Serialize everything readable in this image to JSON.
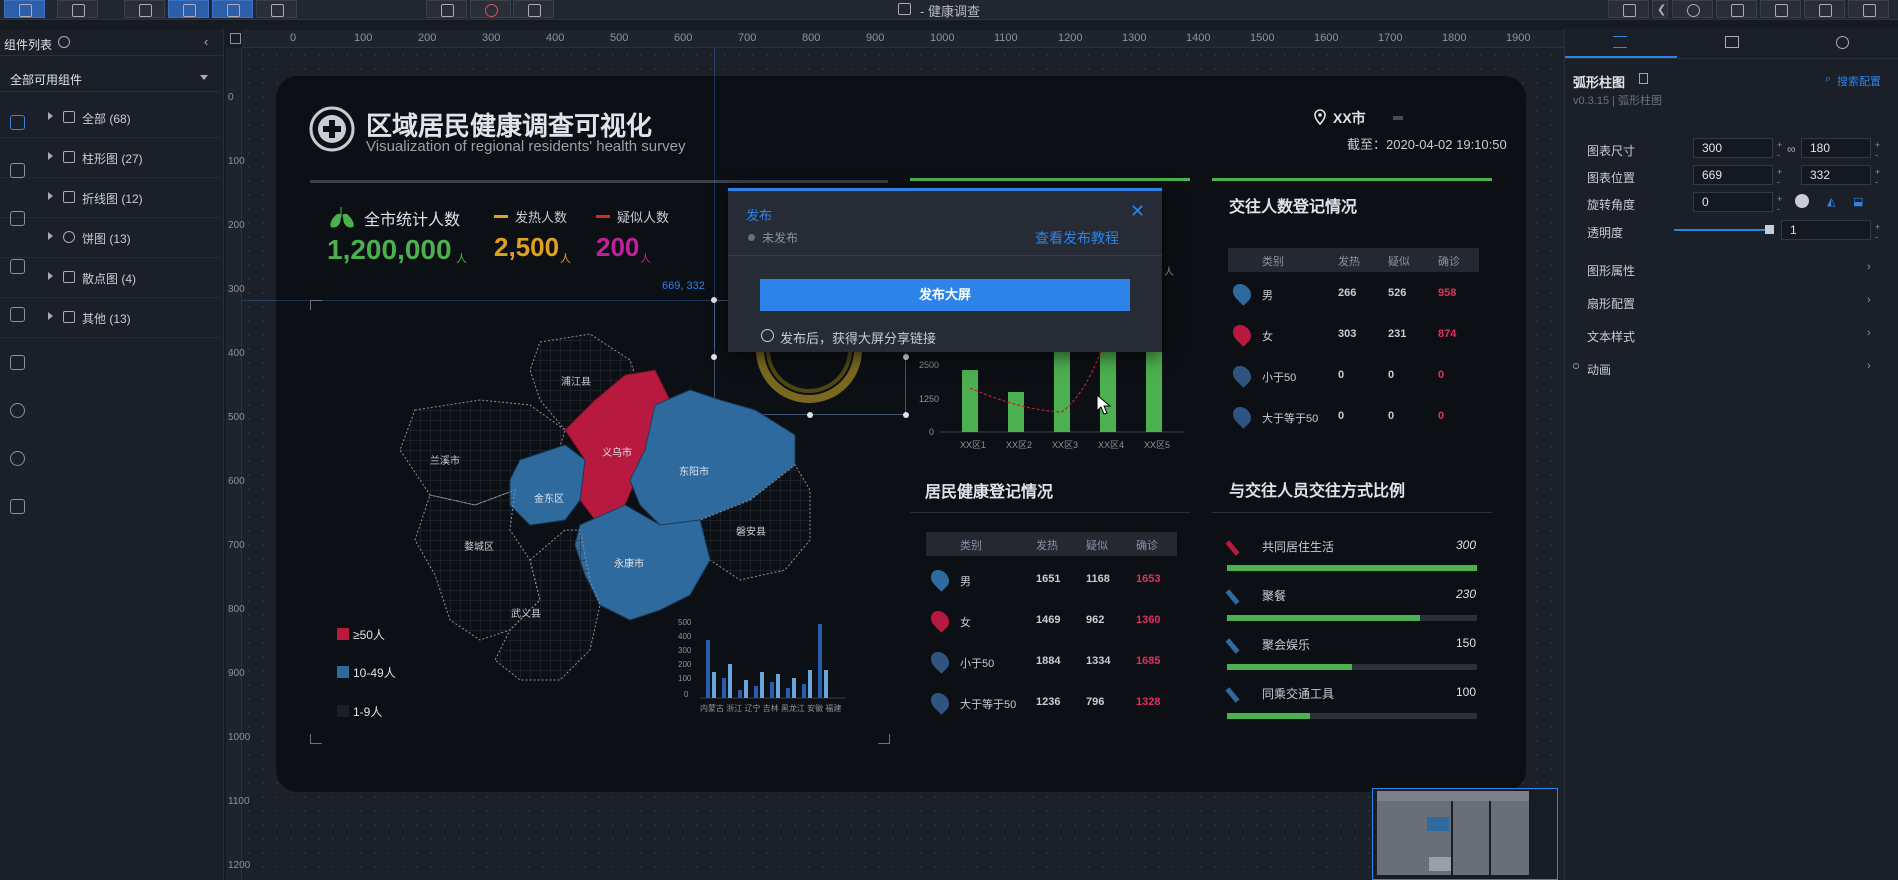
{
  "window_title": "- 健康调查",
  "left_panel": {
    "title": "组件列表",
    "filter": "全部可用组件",
    "items": [
      {
        "label": "全部 (68)"
      },
      {
        "label": "柱形图 (27)"
      },
      {
        "label": "折线图 (12)"
      },
      {
        "label": "饼图 (13)"
      },
      {
        "label": "散点图 (4)"
      },
      {
        "label": "其他 (13)"
      }
    ]
  },
  "ruler": {
    "top": [
      "0",
      "100",
      "200",
      "300",
      "400",
      "500",
      "600",
      "700",
      "800",
      "900",
      "1000",
      "1100",
      "1200",
      "1300",
      "1400",
      "1500",
      "1600",
      "1700",
      "1800",
      "1900"
    ],
    "left": [
      "0",
      "100",
      "200",
      "300",
      "400",
      "500",
      "600",
      "700",
      "800",
      "900",
      "1000",
      "1100",
      "1200"
    ]
  },
  "dashboard": {
    "title": "区域居民健康调查可视化",
    "subtitle": "Visualization of regional residents' health survey",
    "city": "XX市",
    "date_label": "截至：2020-04-02 19:10:50",
    "stats": [
      {
        "label": "全市统计人数",
        "value": "1,200,000",
        "unit": "人",
        "color": "#4caf50"
      },
      {
        "label": "发热人数",
        "value": "2,500",
        "unit": "人",
        "color": "#e0a020"
      },
      {
        "label": "疑似人数",
        "value": "200",
        "unit": "人",
        "color": "#c0209a"
      }
    ],
    "coord_label": "669, 332",
    "map_regions": [
      "浦江县",
      "兰溪市",
      "义乌市",
      "东阳市",
      "金东区",
      "婺城区",
      "磐安县",
      "永康市",
      "武义县"
    ],
    "map_legend": [
      {
        "label": "≥50人",
        "color": "#b8193f"
      },
      {
        "label": "10-49人",
        "color": "#2f6a9e"
      },
      {
        "label": "1-9人",
        "color": "#1c1f25"
      }
    ],
    "mini_chart": {
      "y_ticks": [
        "500",
        "400",
        "300",
        "200",
        "100",
        "0"
      ],
      "x_labels": "内蒙古 浙江 辽宁 吉林 黑龙江 安徽 福建"
    },
    "bar_chart": {
      "y_ticks": [
        "2500",
        "1250",
        "0"
      ],
      "categories": [
        "XX区1",
        "XX区2",
        "XX区3",
        "XX区4",
        "XX区5"
      ],
      "unit": "人"
    },
    "contact_reg": {
      "title": "交往人数登记情况",
      "headers": [
        "类别",
        "发热",
        "疑似",
        "确诊"
      ],
      "rows": [
        {
          "cat": "男",
          "a": "266",
          "b": "526",
          "c": "958"
        },
        {
          "cat": "女",
          "a": "303",
          "b": "231",
          "c": "874"
        },
        {
          "cat": "小于50",
          "a": "0",
          "b": "0",
          "c": "0"
        },
        {
          "cat": "大于等于50",
          "a": "0",
          "b": "0",
          "c": "0"
        }
      ]
    },
    "resident_reg": {
      "title": "居民健康登记情况",
      "headers": [
        "类别",
        "发热",
        "疑似",
        "确诊"
      ],
      "rows": [
        {
          "cat": "男",
          "a": "1651",
          "b": "1168",
          "c": "1653"
        },
        {
          "cat": "女",
          "a": "1469",
          "b": "962",
          "c": "1360"
        },
        {
          "cat": "小于50",
          "a": "1884",
          "b": "1334",
          "c": "1685"
        },
        {
          "cat": "大于等于50",
          "a": "1236",
          "b": "796",
          "c": "1328"
        }
      ]
    },
    "contact_ratio": {
      "title": "与交往人员交往方式比例",
      "items": [
        {
          "label": "共同居住生活",
          "value": "300",
          "level": 1.0
        },
        {
          "label": "聚餐",
          "value": "230",
          "level": 0.77
        },
        {
          "label": "聚会娱乐",
          "value": "150",
          "level": 0.5
        },
        {
          "label": "同乘交通工具",
          "value": "100",
          "level": 0.33
        }
      ]
    }
  },
  "modal": {
    "title": "发布",
    "status": "未发布",
    "tutorial_link": "查看发布教程",
    "publish_button": "发布大屏",
    "hint": "发布后，获得大屏分享链接"
  },
  "right_panel": {
    "component_name": "弧形柱图",
    "version": "v0.3.15 | 弧形柱图",
    "search_config": "搜索配置",
    "rows": [
      {
        "label": "图表尺寸",
        "v1": "300",
        "v2": "180"
      },
      {
        "label": "图表位置",
        "v1": "669",
        "v2": "332"
      },
      {
        "label": "旋转角度",
        "v1": "0"
      },
      {
        "label": "透明度",
        "v1": "1"
      }
    ],
    "sections": [
      "图形属性",
      "扇形配置",
      "文本样式",
      "动画"
    ]
  },
  "colors": {
    "accent": "#2d83e8",
    "green": "#4caf50",
    "red": "#b8193f",
    "blue": "#2f6a9e"
  }
}
